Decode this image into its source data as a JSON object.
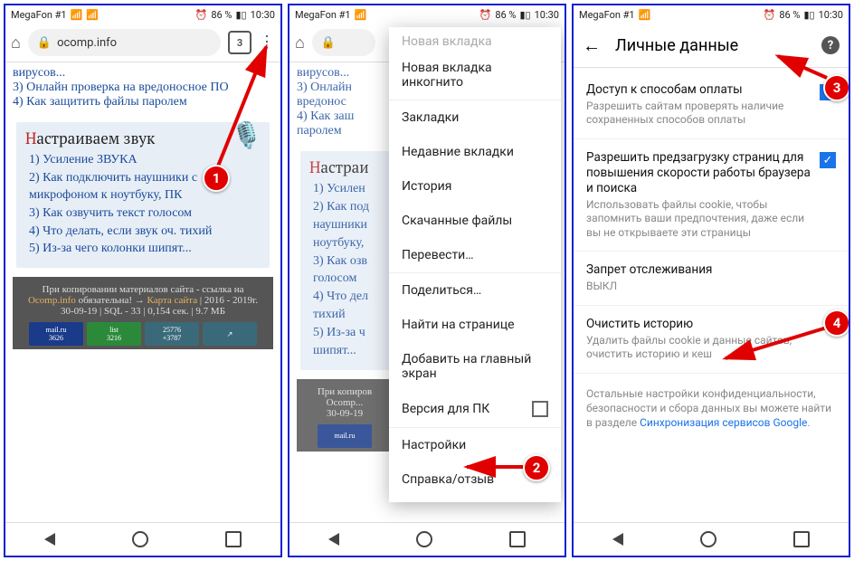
{
  "status": {
    "carrier": "MegaFon #1",
    "battery": "86 %",
    "time": "10:30"
  },
  "chrome": {
    "url": "ocomp.info",
    "tabs": "3"
  },
  "page1": {
    "top_links": [
      "вирусов...",
      "3) Онлайн проверка на вредоносное ПО",
      "4) Как защитить файлы паролем"
    ],
    "section_title_cap": "Н",
    "section_title_rest": "астраиваем звук",
    "list": [
      "1) Усиление ЗВУКА",
      "2) Как подключить наушники с микрофоном к ноутбуку, ПК",
      "3) Как озвучить текст голосом",
      "4) Что делать, если звук оч. тихий",
      "5) Из-за чего колонки шипят..."
    ],
    "footer1": "При копировании материалов сайта - ссылка на",
    "footer_link1": "Ocomp.info",
    "footer2": " обязательна!  → ",
    "footer_link2": "Карта сайта",
    "footer3": " | 2016 - 2019г.",
    "footer_stats": "30-09-19 | SQL - 33 | 0,154 сек. | 9.7 МБ"
  },
  "menu": {
    "items": [
      "Новая вкладка",
      "Новая вкладка инкогнито",
      "Закладки",
      "Недавние вкладки",
      "История",
      "Скачанные файлы",
      "Перевести…",
      "Поделиться…",
      "Найти на странице",
      "Добавить на главный экран",
      "Версия для ПК",
      "Настройки",
      "Справка/отзыв"
    ]
  },
  "settings": {
    "title": "Личные данные",
    "rows": [
      {
        "label": "Доступ к способам оплаты",
        "sub": "Разрешить сайтам проверять наличие сохраненных способов оплаты",
        "checked": true
      },
      {
        "label": "Разрешить предзагрузку страниц для повышения скорости работы браузера и поиска",
        "sub": "Использовать файлы cookie, чтобы запомнить ваши предпочтения, даже если вы не открываете эти страницы",
        "checked": true
      },
      {
        "label": "Запрет отслеживания",
        "sub": "ВЫКЛ",
        "checked": false,
        "nocheck": true
      },
      {
        "label": "Очистить историю",
        "sub": "Удалить файлы cookie и данные сайтов, очистить историю и кеш",
        "checked": false,
        "nocheck": true
      }
    ],
    "foot1": "Остальные настройки конфиденциальности, безопасности и сбора данных вы можете найти в разделе ",
    "foot_link": "Синхронизация сервисов Google",
    "foot2": "."
  }
}
